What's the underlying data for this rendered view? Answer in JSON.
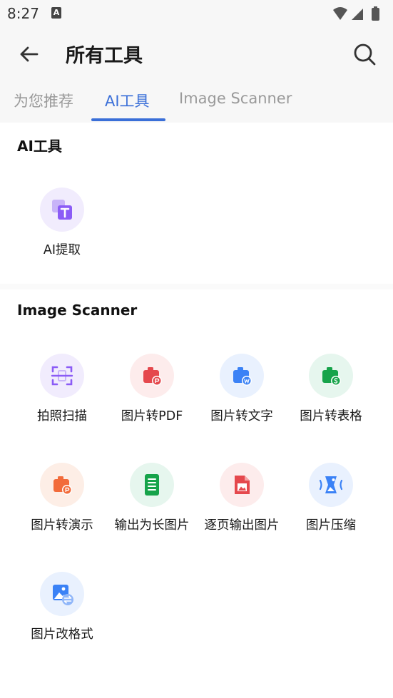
{
  "status_bar": {
    "time": "8:27",
    "notification_icon": "A"
  },
  "app_bar": {
    "title": "所有工具",
    "back_icon": "arrow-left",
    "search_icon": "search"
  },
  "tabs": [
    {
      "label": "为您推荐",
      "active": false
    },
    {
      "label": "AI工具",
      "active": true
    },
    {
      "label": "Image Scanner",
      "active": false
    }
  ],
  "sections": {
    "ai": {
      "title": "AI工具",
      "tools": [
        {
          "label": "AI提取",
          "icon": "ai-extract-icon",
          "color": "#8b5cf6"
        }
      ]
    },
    "scanner": {
      "title": "Image Scanner",
      "tools": [
        {
          "label": "拍照扫描",
          "icon": "scan-icon",
          "color": "#8b5cf6"
        },
        {
          "label": "图片转PDF",
          "icon": "image-to-pdf-icon",
          "color": "#e5484d"
        },
        {
          "label": "图片转文字",
          "icon": "image-to-word-icon",
          "color": "#3b82f6"
        },
        {
          "label": "图片转表格",
          "icon": "image-to-sheet-icon",
          "color": "#16a34a"
        },
        {
          "label": "图片转演示",
          "icon": "image-to-ppt-icon",
          "color": "#f26b3a"
        },
        {
          "label": "输出为长图片",
          "icon": "long-image-icon",
          "color": "#16a34a"
        },
        {
          "label": "逐页输出图片",
          "icon": "page-images-icon",
          "color": "#e5484d"
        },
        {
          "label": "图片压缩",
          "icon": "compress-icon",
          "color": "#3b82f6"
        },
        {
          "label": "图片改格式",
          "icon": "convert-format-icon",
          "color": "#3b82f6"
        }
      ]
    }
  },
  "colors": {
    "accent": "#3a6fd8",
    "background": "#ffffff",
    "header_bg": "#f7f7f7"
  }
}
